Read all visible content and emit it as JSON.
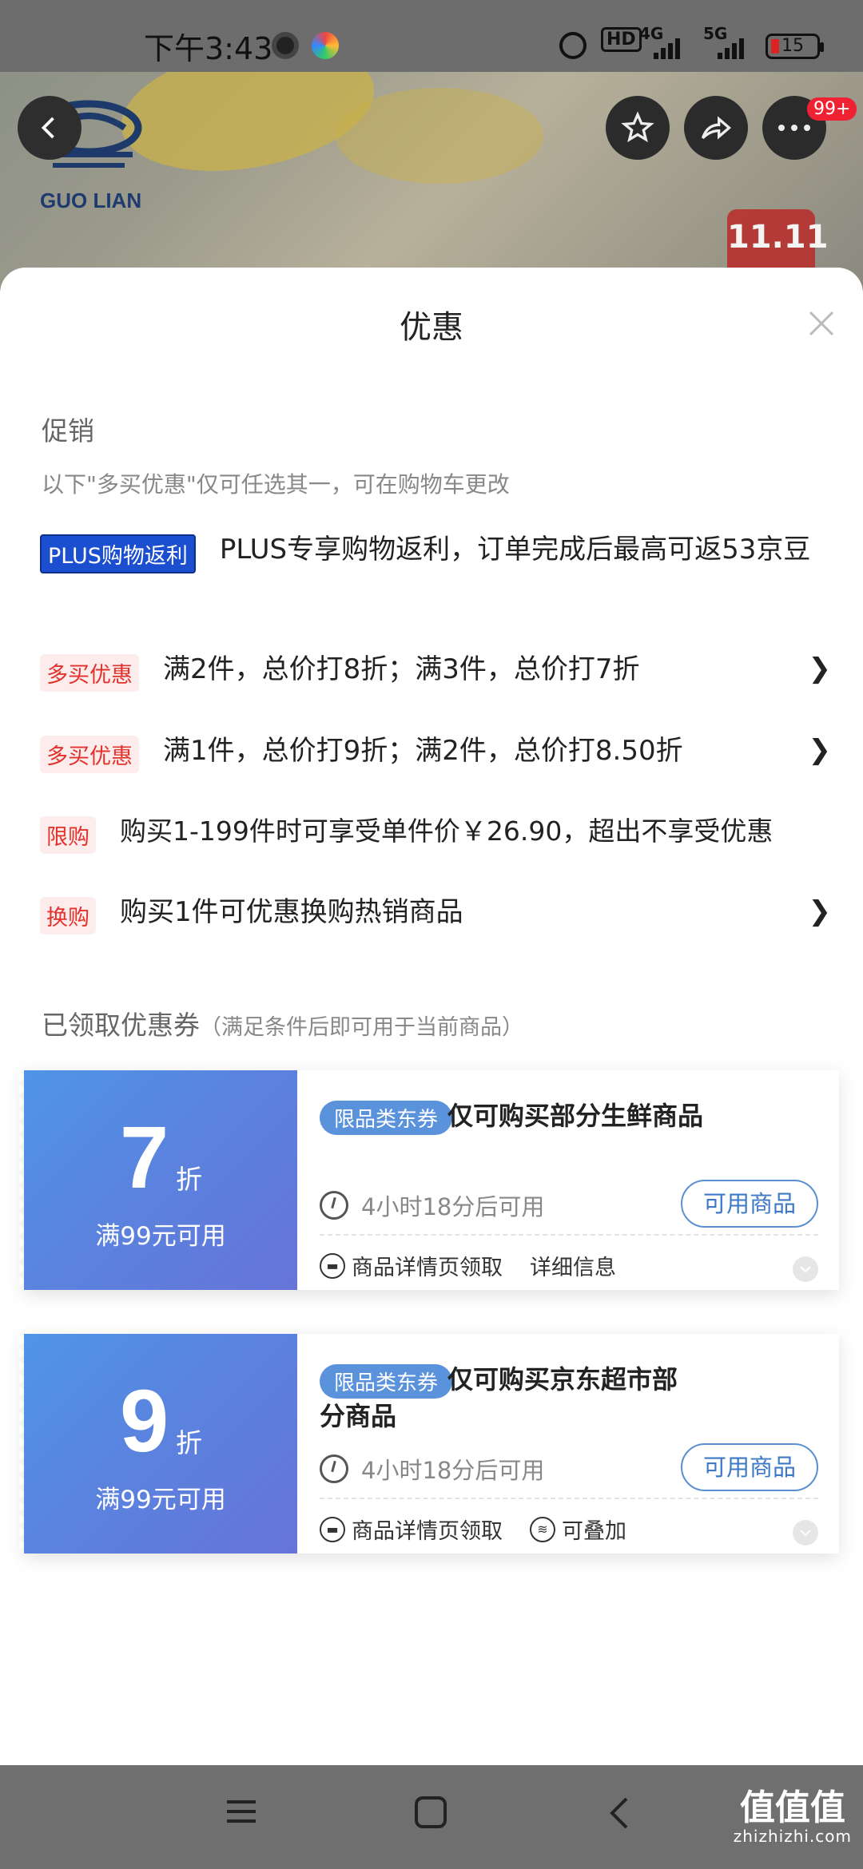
{
  "status_bar": {
    "time": "下午3:43",
    "hd_label": "HD",
    "net1": "4G",
    "net2": "5G",
    "battery": "15"
  },
  "header": {
    "brand_text": "GUO LIAN",
    "more_badge": "99+",
    "promo_badge": "11.11"
  },
  "sheet": {
    "title": "优惠",
    "promotion_section": {
      "label": "促销",
      "hint": "以下\"多买优惠\"仅可任选其一，可在购物车更改",
      "items": [
        {
          "tag": "PLUS购物返利",
          "text": "PLUS专享购物返利，订单完成后最高可返53京豆",
          "chevron": ""
        },
        {
          "tag": "多买优惠",
          "text": "满2件，总价打8折；满3件，总价打7折",
          "chevron": "❯"
        },
        {
          "tag": "多买优惠",
          "text": "满1件，总价打9折；满2件，总价打8.50折",
          "chevron": "❯"
        },
        {
          "tag": "限购",
          "text": "购买1-199件时可享受单件价￥26.90，超出不享受优惠",
          "chevron": ""
        },
        {
          "tag": "换购",
          "text": "购买1件可优惠换购热销商品",
          "chevron": "❯"
        }
      ]
    },
    "coupon_section": {
      "label": "已领取优惠券",
      "sub": "（满足条件后即可用于当前商品）",
      "coupons": [
        {
          "discount": "7",
          "unit": "折",
          "condition": "满99元可用",
          "category_tag": "限品类东券",
          "description": "仅可购买部分生鲜商品",
          "timer": "4小时18分后可用",
          "button": "可用商品",
          "source": "商品详情页领取",
          "extra": "详细信息"
        },
        {
          "discount": "9",
          "unit": "折",
          "condition": "满99元可用",
          "category_tag": "限品类东券",
          "description": "仅可购买京东超市部分商品",
          "timer": "4小时18分后可用",
          "button": "可用商品",
          "source": "商品详情页领取",
          "extra": "可叠加"
        }
      ]
    }
  },
  "watermark": {
    "main": "值值值",
    "sub": "zhizhizhi.com"
  },
  "colors": {
    "plus_tag": "#1b4fcf",
    "red_tag_text": "#e2322c",
    "red_tag_bg": "#fdecec",
    "coupon_gradient_start": "#4f95e6",
    "coupon_gradient_end": "#6674d8",
    "accent_blue": "#3e79c6"
  }
}
